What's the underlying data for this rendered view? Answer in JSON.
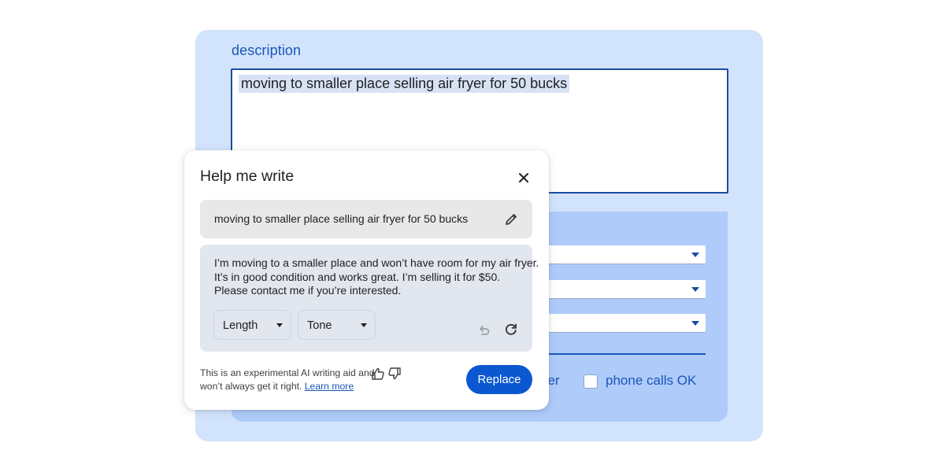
{
  "form": {
    "description_label": "description",
    "description_value": "moving to smaller place selling air fryer for 50 bucks",
    "partial_checkbox_label": "ber",
    "phone_calls_label": "phone calls OK",
    "phone_calls_checked": false,
    "select_fields": [
      "",
      "",
      ""
    ]
  },
  "help_me_write": {
    "title": "Help me write",
    "close_icon": "close-icon",
    "prompt": "moving to smaller place selling air fryer for 50 bucks",
    "edit_icon": "pencil-icon",
    "result_lines": [
      "I’m moving to a smaller place and won’t have room for my air fryer.",
      "It’s in good condition and works great. I’m selling it for $50.",
      "Please contact me if you’re interested."
    ],
    "length_label": "Length",
    "tone_label": "Tone",
    "undo_icon": "undo-icon",
    "refresh_icon": "refresh-icon",
    "disclaimer_line1": "This is an experimental AI writing aid and",
    "disclaimer_line2": "won’t always get it right.",
    "learn_more": "Learn more",
    "thumbs_up_icon": "thumbs-up-icon",
    "thumbs_down_icon": "thumbs-down-icon",
    "replace_label": "Replace"
  },
  "colors": {
    "accent": "#0b57d0",
    "label_blue": "#1a56b8",
    "outer_card": "#d2e3fc",
    "inner_panel": "#aecbfa"
  }
}
